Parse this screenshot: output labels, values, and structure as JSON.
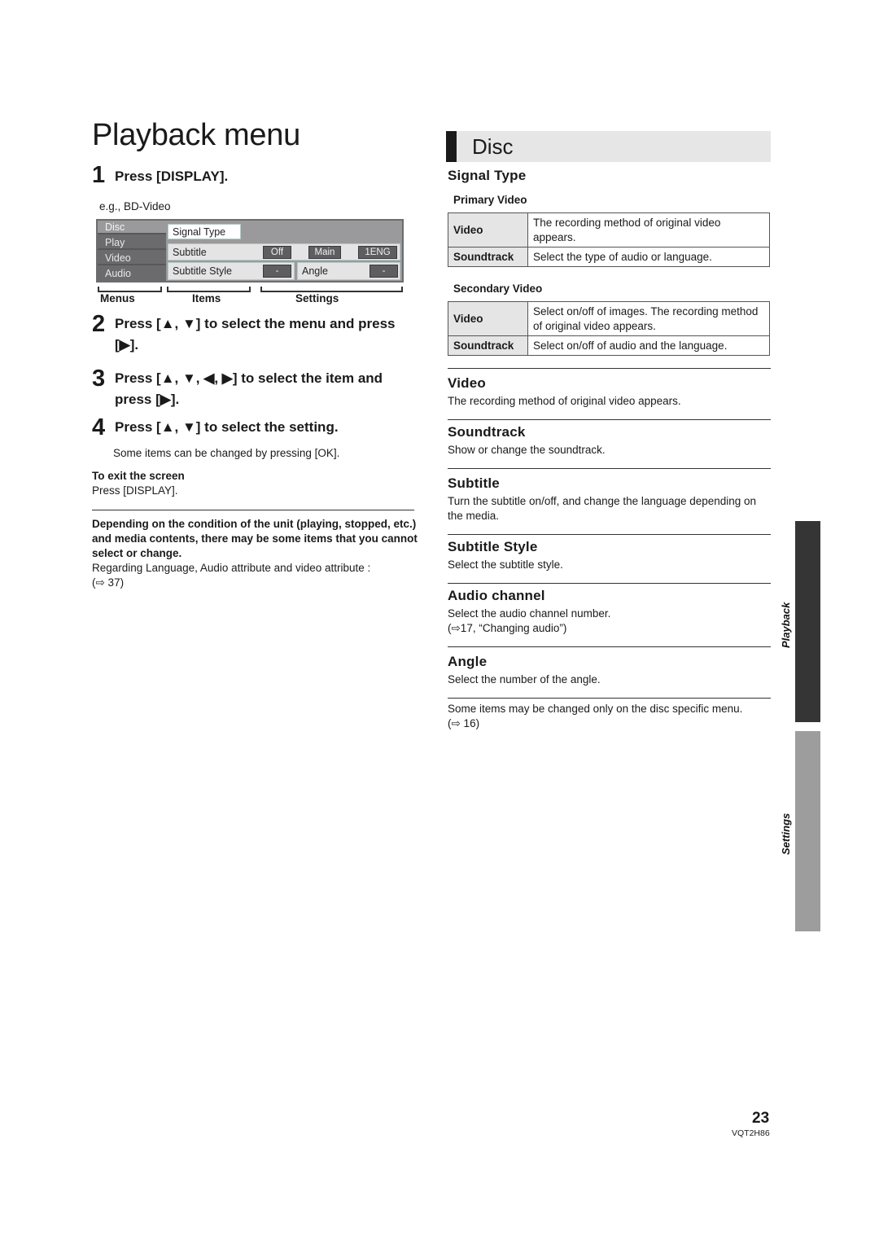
{
  "page": {
    "title": "Playback menu",
    "page_number": "23",
    "doc_code": "VQT2H86"
  },
  "steps": [
    {
      "num": "1",
      "text": "Press [DISPLAY]."
    },
    {
      "num": "2",
      "text": "Press [▲, ▼] to select the menu and press [▶]."
    },
    {
      "num": "3",
      "text": "Press [▲, ▼, ◀, ▶] to select the item and press [▶]."
    },
    {
      "num": "4",
      "text": "Press [▲, ▼] to select the setting."
    }
  ],
  "example": {
    "label": "e.g., BD-Video",
    "osd": {
      "menus": [
        "Disc",
        "Play",
        "Video",
        "Audio"
      ],
      "active_menu": "Disc",
      "items": {
        "signal_type": "Signal Type",
        "subtitle": "Subtitle",
        "subtitle_values": [
          "Off",
          "Main",
          "1ENG"
        ],
        "subtitle_style": "Subtitle Style",
        "subtitle_style_value": "-",
        "angle": "Angle",
        "angle_value": "-"
      }
    },
    "legend": {
      "menus": "Menus",
      "items": "Items",
      "settings": "Settings"
    }
  },
  "notes": {
    "ok_note": "Some items can be changed by pressing [OK].",
    "exit_title": "To exit the screen",
    "exit_body": "Press [DISPLAY].",
    "condition_bold": "Depending on the condition of the unit (playing, stopped, etc.) and media contents, there may be some items that you cannot select or change.",
    "condition_ref_line1": "Regarding Language, Audio attribute and video attribute :",
    "condition_ref_line2": "(⇨ 37)"
  },
  "disc": {
    "header": "Disc",
    "signal_type": {
      "title": "Signal Type",
      "primary": {
        "title": "Primary Video",
        "rows": [
          {
            "key": "Video",
            "value": "The recording method of original video appears."
          },
          {
            "key": "Soundtrack",
            "value": "Select the type of audio or language."
          }
        ]
      },
      "secondary": {
        "title": "Secondary Video",
        "rows": [
          {
            "key": "Video",
            "value": "Select on/off of images. The recording method of original video appears."
          },
          {
            "key": "Soundtrack",
            "value": "Select on/off of audio and the language."
          }
        ]
      }
    },
    "sections": [
      {
        "title": "Video",
        "desc": "The recording method of original video appears."
      },
      {
        "title": "Soundtrack",
        "desc": "Show or change the soundtrack."
      },
      {
        "title": "Subtitle",
        "desc": "Turn the subtitle on/off, and change the language depending on the media."
      },
      {
        "title": "Subtitle Style",
        "desc": "Select the subtitle style."
      },
      {
        "title": "Audio channel",
        "desc": "Select the audio channel number.",
        "ref": "(⇨17, “Changing audio”)"
      },
      {
        "title": "Angle",
        "desc": "Select the number of the angle."
      }
    ],
    "footer_note": "Some items may be changed only on the disc specific menu.",
    "footer_ref": "(⇨ 16)"
  },
  "side_tabs": [
    {
      "label": "Playback",
      "active": true
    },
    {
      "label": "Settings",
      "active": false
    }
  ]
}
